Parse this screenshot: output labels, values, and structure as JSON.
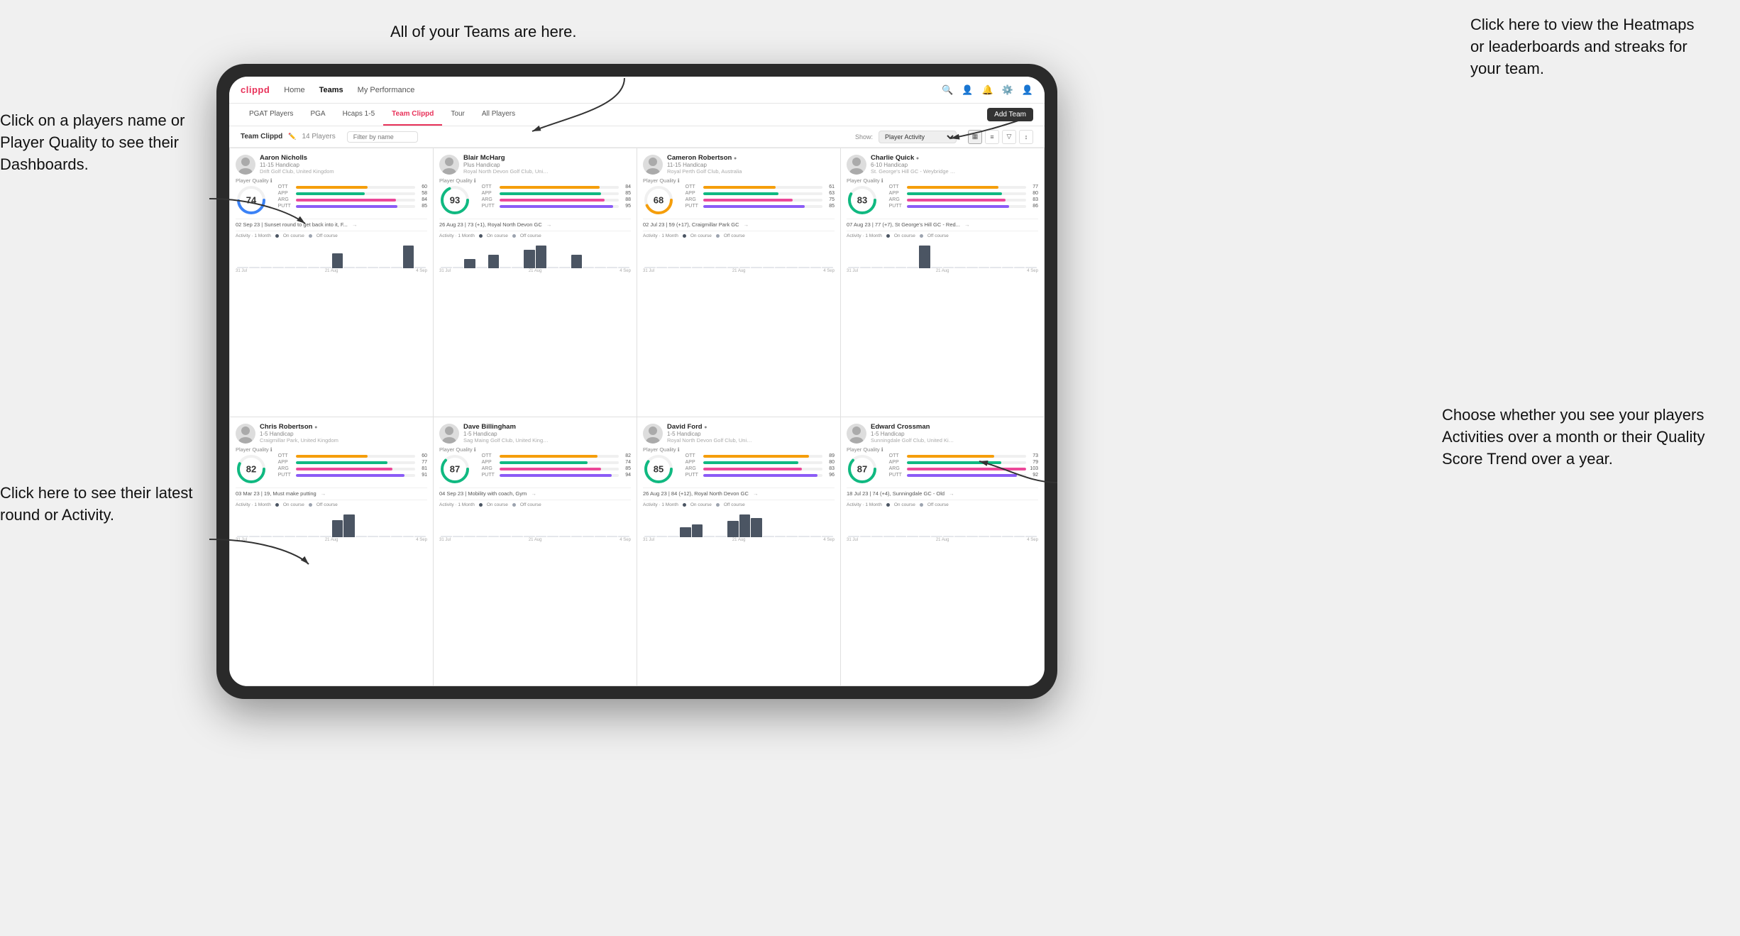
{
  "annotations": {
    "top_center": "All of your Teams are here.",
    "top_right": "Click here to view the\nHeatmaps or leaderboards\nand streaks for your team.",
    "left_top": "Click on a players name\nor Player Quality to see\ntheir Dashboards.",
    "left_bottom": "Click here to see their latest\nround or Activity.",
    "right_middle": "Choose whether you see\nyour players Activities over\na month or their Quality\nScore Trend over a year."
  },
  "nav": {
    "logo": "clippd",
    "items": [
      "Home",
      "Teams",
      "My Performance"
    ],
    "icons": [
      "🔍",
      "👤",
      "🔔",
      "⚙",
      "👤"
    ]
  },
  "sub_tabs": [
    "PGAT Players",
    "PGA",
    "Hcaps 1-5",
    "Team Clippd",
    "Tour",
    "All Players"
  ],
  "active_sub_tab": "Team Clippd",
  "team_header": {
    "title": "Team Clippd",
    "count": "14 Players",
    "filter_placeholder": "Filter by name",
    "show_label": "Show:",
    "show_option": "Player Activity",
    "add_team_label": "Add Team"
  },
  "players": [
    {
      "id": "p1",
      "name": "Aaron Nicholls",
      "handicap": "11-15 Handicap",
      "club": "Drift Golf Club, United Kingdom",
      "quality": 74,
      "quality_color": "#3b82f6",
      "bars": [
        {
          "label": "OTT",
          "value": 60,
          "color": "#f59e0b"
        },
        {
          "label": "APP",
          "value": 58,
          "color": "#10b981"
        },
        {
          "label": "ARG",
          "value": 84,
          "color": "#ec4899"
        },
        {
          "label": "PUTT",
          "value": 85,
          "color": "#8b5cf6"
        }
      ],
      "last_round": "02 Sep 23 | Sunset round to get back into it, F...",
      "activity_bars": [
        0,
        0,
        0,
        0,
        0,
        0,
        0,
        0,
        2,
        0,
        0,
        0,
        0,
        0,
        3,
        0
      ],
      "chart_dates": [
        "31 Jul",
        "21 Aug",
        "4 Sep"
      ]
    },
    {
      "id": "p2",
      "name": "Blair McHarg",
      "handicap": "Plus Handicap",
      "club": "Royal North Devon Golf Club, United Ki...",
      "quality": 93,
      "quality_color": "#10b981",
      "bars": [
        {
          "label": "OTT",
          "value": 84,
          "color": "#f59e0b"
        },
        {
          "label": "APP",
          "value": 85,
          "color": "#10b981"
        },
        {
          "label": "ARG",
          "value": 88,
          "color": "#ec4899"
        },
        {
          "label": "PUTT",
          "value": 95,
          "color": "#8b5cf6"
        }
      ],
      "last_round": "26 Aug 23 | 73 (+1), Royal North Devon GC",
      "activity_bars": [
        0,
        0,
        2,
        0,
        3,
        0,
        0,
        4,
        5,
        0,
        0,
        3,
        0,
        0,
        0,
        0
      ],
      "chart_dates": [
        "31 Jul",
        "21 Aug",
        "4 Sep"
      ]
    },
    {
      "id": "p3",
      "name": "Cameron Robertson",
      "handicap": "11-15 Handicap",
      "club": "Royal Perth Golf Club, Australia",
      "quality": 68,
      "quality_color": "#f59e0b",
      "bars": [
        {
          "label": "OTT",
          "value": 61,
          "color": "#f59e0b"
        },
        {
          "label": "APP",
          "value": 63,
          "color": "#10b981"
        },
        {
          "label": "ARG",
          "value": 75,
          "color": "#ec4899"
        },
        {
          "label": "PUTT",
          "value": 85,
          "color": "#8b5cf6"
        }
      ],
      "last_round": "02 Jul 23 | 59 (+17), Craigmillar Park GC",
      "activity_bars": [
        0,
        0,
        0,
        0,
        0,
        0,
        0,
        0,
        0,
        0,
        0,
        0,
        0,
        0,
        0,
        0
      ],
      "chart_dates": [
        "31 Jul",
        "21 Aug",
        "4 Sep"
      ]
    },
    {
      "id": "p4",
      "name": "Charlie Quick",
      "handicap": "6-10 Handicap",
      "club": "St. George's Hill GC - Weybridge - Surrey...",
      "quality": 83,
      "quality_color": "#10b981",
      "bars": [
        {
          "label": "OTT",
          "value": 77,
          "color": "#f59e0b"
        },
        {
          "label": "APP",
          "value": 80,
          "color": "#10b981"
        },
        {
          "label": "ARG",
          "value": 83,
          "color": "#ec4899"
        },
        {
          "label": "PUTT",
          "value": 86,
          "color": "#8b5cf6"
        }
      ],
      "last_round": "07 Aug 23 | 77 (+7), St George's Hill GC - Red...",
      "activity_bars": [
        0,
        0,
        0,
        0,
        0,
        0,
        3,
        0,
        0,
        0,
        0,
        0,
        0,
        0,
        0,
        0
      ],
      "chart_dates": [
        "31 Jul",
        "21 Aug",
        "4 Sep"
      ]
    },
    {
      "id": "p5",
      "name": "Chris Robertson",
      "handicap": "1-5 Handicap",
      "club": "Craigmillar Park, United Kingdom",
      "quality": 82,
      "quality_color": "#10b981",
      "bars": [
        {
          "label": "OTT",
          "value": 60,
          "color": "#f59e0b"
        },
        {
          "label": "APP",
          "value": 77,
          "color": "#10b981"
        },
        {
          "label": "ARG",
          "value": 81,
          "color": "#ec4899"
        },
        {
          "label": "PUTT",
          "value": 91,
          "color": "#8b5cf6"
        }
      ],
      "last_round": "03 Mar 23 | 19, Must make putting",
      "activity_bars": [
        0,
        0,
        0,
        0,
        0,
        0,
        0,
        0,
        3,
        4,
        0,
        0,
        0,
        0,
        0,
        0
      ],
      "chart_dates": [
        "31 Jul",
        "21 Aug",
        "4 Sep"
      ]
    },
    {
      "id": "p6",
      "name": "Dave Billingham",
      "handicap": "1-5 Handicap",
      "club": "Sag Maing Golf Club, United Kingdom",
      "quality": 87,
      "quality_color": "#10b981",
      "bars": [
        {
          "label": "OTT",
          "value": 82,
          "color": "#f59e0b"
        },
        {
          "label": "APP",
          "value": 74,
          "color": "#10b981"
        },
        {
          "label": "ARG",
          "value": 85,
          "color": "#ec4899"
        },
        {
          "label": "PUTT",
          "value": 94,
          "color": "#8b5cf6"
        }
      ],
      "last_round": "04 Sep 23 | Mobility with coach, Gym",
      "activity_bars": [
        0,
        0,
        0,
        0,
        0,
        0,
        0,
        0,
        0,
        0,
        0,
        0,
        0,
        0,
        0,
        0
      ],
      "chart_dates": [
        "31 Jul",
        "21 Aug",
        "4 Sep"
      ]
    },
    {
      "id": "p7",
      "name": "David Ford",
      "handicap": "1-5 Handicap",
      "club": "Royal North Devon Golf Club, United Ki...",
      "quality": 85,
      "quality_color": "#10b981",
      "bars": [
        {
          "label": "OTT",
          "value": 89,
          "color": "#f59e0b"
        },
        {
          "label": "APP",
          "value": 80,
          "color": "#10b981"
        },
        {
          "label": "ARG",
          "value": 83,
          "color": "#ec4899"
        },
        {
          "label": "PUTT",
          "value": 96,
          "color": "#8b5cf6"
        }
      ],
      "last_round": "26 Aug 23 | 84 (+12), Royal North Devon GC",
      "activity_bars": [
        0,
        0,
        0,
        3,
        4,
        0,
        0,
        5,
        7,
        6,
        0,
        0,
        0,
        0,
        0,
        0
      ],
      "chart_dates": [
        "31 Jul",
        "21 Aug",
        "4 Sep"
      ]
    },
    {
      "id": "p8",
      "name": "Edward Crossman",
      "handicap": "1-5 Handicap",
      "club": "Sunningdale Golf Club, United Kingdom",
      "quality": 87,
      "quality_color": "#10b981",
      "bars": [
        {
          "label": "OTT",
          "value": 73,
          "color": "#f59e0b"
        },
        {
          "label": "APP",
          "value": 79,
          "color": "#10b981"
        },
        {
          "label": "ARG",
          "value": 103,
          "color": "#ec4899"
        },
        {
          "label": "PUTT",
          "value": 92,
          "color": "#8b5cf6"
        }
      ],
      "last_round": "18 Jul 23 | 74 (+4), Sunningdale GC - Old",
      "activity_bars": [
        0,
        0,
        0,
        0,
        0,
        0,
        0,
        0,
        0,
        0,
        0,
        0,
        0,
        0,
        0,
        0
      ],
      "chart_dates": [
        "31 Jul",
        "21 Aug",
        "4 Sep"
      ]
    }
  ]
}
